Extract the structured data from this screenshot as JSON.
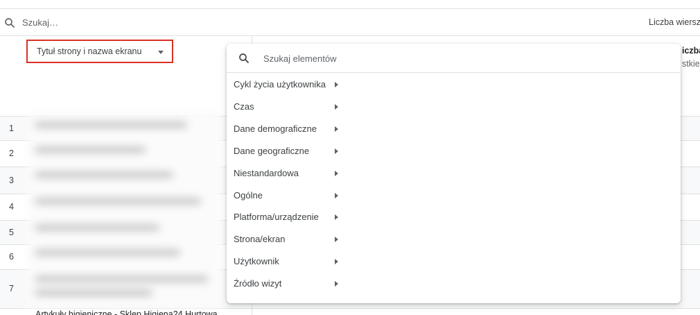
{
  "toolbar": {
    "search_placeholder": "Szukaj…",
    "rows_label": "Liczba wiersz"
  },
  "table": {
    "dimension_label": "Tytuł strony i nazwa ekranu",
    "metric_header": "iczba",
    "metric_subheader": "stkie",
    "row_numbers": [
      "1",
      "2",
      "3",
      "4",
      "5",
      "6",
      "7"
    ],
    "bottom_row_text": "Artykuły higieniczne - Sklep Higiena24 Hurtowa"
  },
  "dropdown": {
    "search_placeholder": "Szukaj elementów",
    "items": [
      {
        "label": "Cykl życia użytkownika"
      },
      {
        "label": "Czas"
      },
      {
        "label": "Dane demograficzne"
      },
      {
        "label": "Dane geograficzne"
      },
      {
        "label": "Niestandardowa"
      },
      {
        "label": "Ogólne"
      },
      {
        "label": "Platforma/urządzenie"
      },
      {
        "label": "Strona/ekran"
      },
      {
        "label": "Użytkownik"
      },
      {
        "label": "Źródło wizyt"
      }
    ]
  },
  "colors": {
    "highlight_border": "#d93025",
    "divider": "#e0e0e0",
    "text": "#3c4043"
  }
}
